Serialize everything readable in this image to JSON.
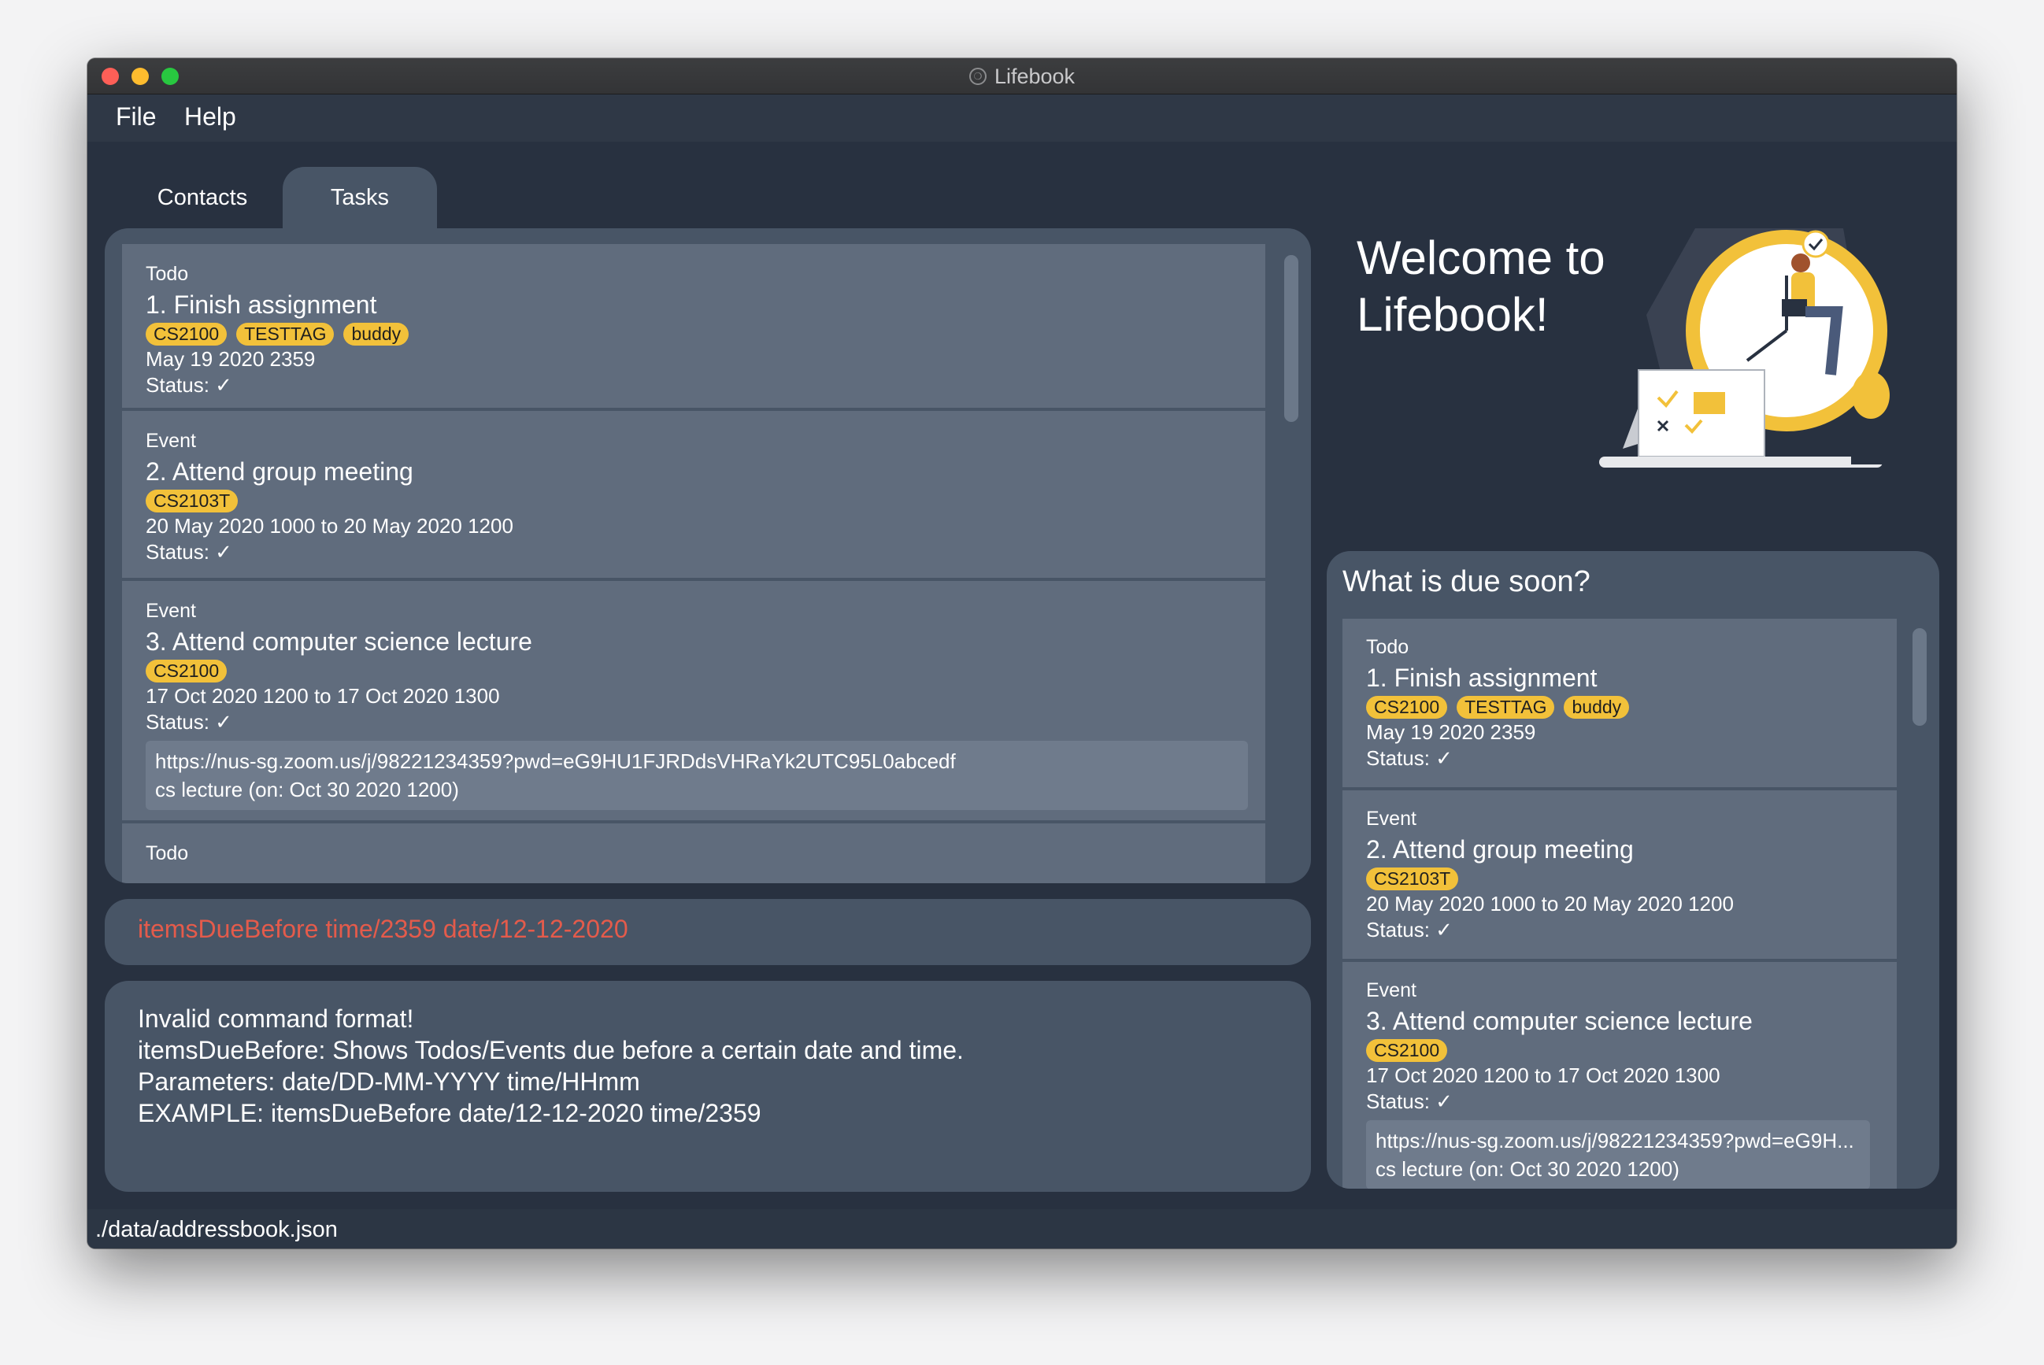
{
  "window": {
    "title": "Lifebook",
    "traffic_lights": [
      "close",
      "minimize",
      "maximize"
    ]
  },
  "menu": {
    "file_label": "File",
    "help_label": "Help"
  },
  "tabs": [
    {
      "label": "Contacts",
      "selected": false
    },
    {
      "label": "Tasks",
      "selected": true
    }
  ],
  "task_list": {
    "items": [
      {
        "type": "Todo",
        "title": "1.  Finish assignment",
        "tags": [
          "CS2100",
          "TESTTAG",
          "buddy"
        ],
        "date": "May 19 2020 2359",
        "status": "Status: ✓"
      },
      {
        "type": "Event",
        "title": "2.  Attend group meeting",
        "tags": [
          "CS2103T"
        ],
        "date": "20 May 2020 1000 to 20 May 2020 1200",
        "status": "Status: ✓"
      },
      {
        "type": "Event",
        "title": "3.  Attend computer science lecture",
        "tags": [
          "CS2100"
        ],
        "date": "17 Oct 2020 1200 to 17 Oct 2020 1300",
        "status": "Status: ✓",
        "link": "https://nus-sg.zoom.us/j/98221234359?pwd=eG9HU1FJRDdsVHRaYk2UTC95L0abcedf",
        "link_note": "cs lecture (on: Oct 30 2020 1200)"
      },
      {
        "type": "Todo"
      }
    ]
  },
  "command_box": {
    "text": "itemsDueBefore time/2359 date/12-12-2020"
  },
  "result_box": {
    "text": "Invalid command format!\nitemsDueBefore: Shows Todos/Events due before a certain date and time.\nParameters: date/DD-MM-YYYY time/HHmm\nEXAMPLE: itemsDueBefore date/12-12-2020 time/2359"
  },
  "status_bar": {
    "path": "./data/addressbook.json"
  },
  "welcome": {
    "text": "Welcome to\nLifebook!"
  },
  "due_soon": {
    "title": "What is due soon?",
    "items": [
      {
        "type": "Todo",
        "title": "1.  Finish assignment",
        "tags": [
          "CS2100",
          "TESTTAG",
          "buddy"
        ],
        "date": "May 19 2020 2359",
        "status": "Status: ✓"
      },
      {
        "type": "Event",
        "title": "2.  Attend group meeting",
        "tags": [
          "CS2103T"
        ],
        "date": "20 May 2020 1000 to 20 May 2020 1200",
        "status": "Status: ✓"
      },
      {
        "type": "Event",
        "title": "3.  Attend computer science lecture",
        "tags": [
          "CS2100"
        ],
        "date": "17 Oct 2020 1200 to 17 Oct 2020 1300",
        "status": "Status: ✓",
        "link": "https://nus-sg.zoom.us/j/98221234359?pwd=eG9H...",
        "link_note": "cs lecture (on: Oct 30 2020 1200)"
      }
    ]
  },
  "colors": {
    "window_bg": "#283140",
    "panel_bg": "#485566",
    "card_bg": "#606c7d",
    "tag_bg": "#f2c13a",
    "command_text": "#e45b4b"
  }
}
